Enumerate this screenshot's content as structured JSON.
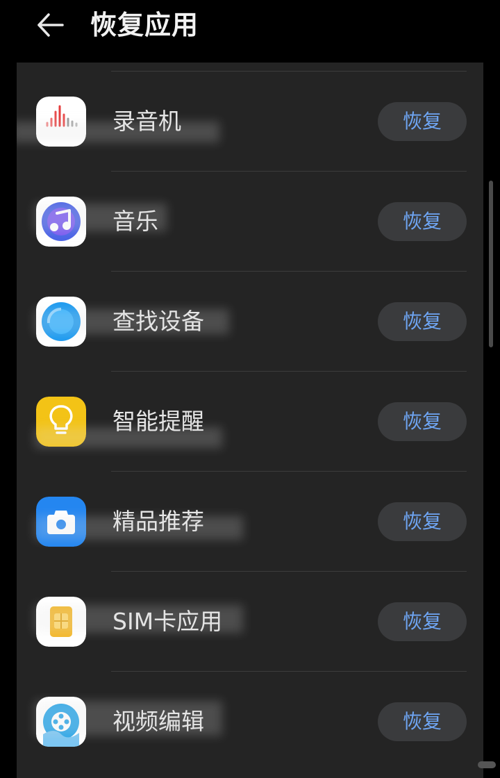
{
  "header": {
    "back_icon": "arrow-left-icon",
    "title": "恢复应用"
  },
  "apps": [
    {
      "name": "录音机",
      "icon": "recorder-icon",
      "restore_label": "恢复"
    },
    {
      "name": "音乐",
      "icon": "music-icon",
      "restore_label": "恢复"
    },
    {
      "name": "查找设备",
      "icon": "find-device-icon",
      "restore_label": "恢复"
    },
    {
      "name": "智能提醒",
      "icon": "smart-reminder-icon",
      "restore_label": "恢复"
    },
    {
      "name": "精品推荐",
      "icon": "recommendations-icon",
      "restore_label": "恢复"
    },
    {
      "name": "SIM卡应用",
      "icon": "sim-card-icon",
      "restore_label": "恢复"
    },
    {
      "name": "视频编辑",
      "icon": "video-editor-icon",
      "restore_label": "恢复"
    }
  ],
  "colors": {
    "background": "#000000",
    "card": "#242424",
    "button_bg": "#3a3b3d",
    "accent": "#6fa6f4",
    "text": "#e6e6e6"
  }
}
